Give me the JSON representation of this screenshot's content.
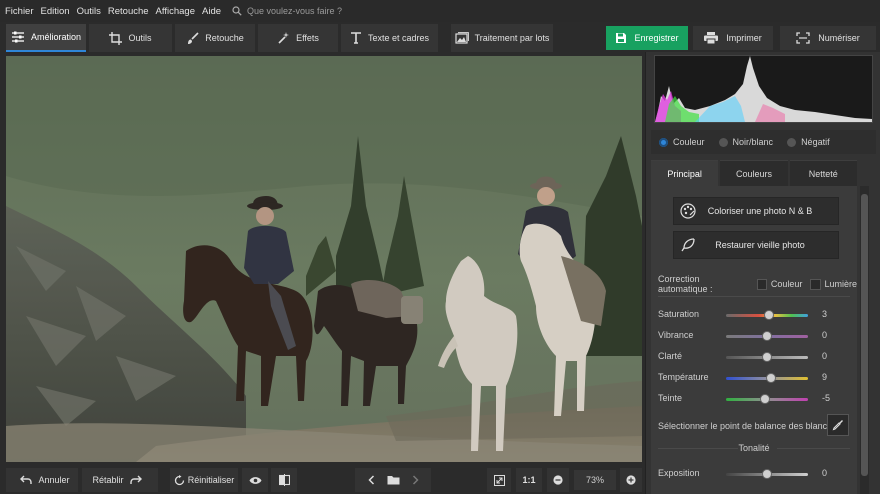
{
  "menu": {
    "items": [
      "Fichier",
      "Edition",
      "Outils",
      "Retouche",
      "Affichage",
      "Aide"
    ],
    "search_placeholder": "Que voulez-vous faire ?"
  },
  "toolbar": {
    "tabs": [
      "Amélioration",
      "Outils",
      "Retouche",
      "Effets",
      "Texte et cadres"
    ],
    "batch_label": "Traitement par lots",
    "save_label": "Enregistrer",
    "print_label": "Imprimer",
    "scan_label": "Numériser"
  },
  "bottom": {
    "undo_label": "Annuler",
    "redo_label": "Rétablir",
    "reset_label": "Réinitialiser",
    "fit_label": "1:1",
    "zoom_value": "73%"
  },
  "panel": {
    "modes": [
      "Couleur",
      "Noir/blanc",
      "Négatif"
    ],
    "selected_mode": "Couleur",
    "tabs": [
      "Principal",
      "Couleurs",
      "Netteté"
    ],
    "colorize_label": "Coloriser une photo N & B",
    "restore_label": "Restaurer vieille photo",
    "auto_label": "Correction automatique :",
    "auto_color": "Couleur",
    "auto_light": "Lumière",
    "sliders": [
      {
        "name": "Saturation",
        "value": "3",
        "level": 0.52
      },
      {
        "name": "Vibrance",
        "value": "0",
        "level": 0.5
      },
      {
        "name": "Clarté",
        "value": "0",
        "level": 0.5
      },
      {
        "name": "Température",
        "value": "9",
        "level": 0.55
      },
      {
        "name": "Teinte",
        "value": "-5",
        "level": 0.47
      }
    ],
    "white_balance_label": "Sélectionner le point de balance des blancs",
    "tonality_label": "Tonalité",
    "exposure": {
      "name": "Exposition",
      "value": "0",
      "level": 0.5
    }
  },
  "colors": {
    "accent": "#2f86d8",
    "save": "#18a160"
  }
}
